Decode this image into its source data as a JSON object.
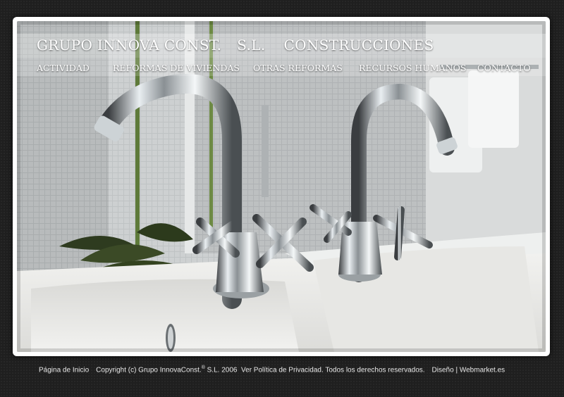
{
  "header": {
    "company": "GRUPO INNOVA CONST.",
    "suffix": "S.L.",
    "tagline": "CONSTRUCCIONES"
  },
  "nav": {
    "items": [
      {
        "label": "ACTIVIDAD"
      },
      {
        "label": "REFORMAS DE VIVIENDAS"
      },
      {
        "label": "OTRAS REFORMAS"
      },
      {
        "label": "RECURSOS HUMANOS"
      },
      {
        "label": "CONTACTO"
      }
    ]
  },
  "hero": {
    "image_subject": "bathroom-faucets-photo"
  },
  "footer": {
    "home_link": "Página de Inicio",
    "copyright_prefix": "Copyright (c) Grupo InnovaConst.",
    "registered_mark": "®",
    "copyright_suffix": "S.L. 2006",
    "privacy_link": "Ver Política de Privacidad.",
    "rights": "Todos los derechos reservados.",
    "design_label": "Diseño",
    "separator": "|",
    "designer_link": "Webmarket.es"
  },
  "colors": {
    "page_bg": "#1f1f1f",
    "frame": "#ffffff",
    "text_light": "#ffffff",
    "footer_text": "#e8e8e8"
  }
}
